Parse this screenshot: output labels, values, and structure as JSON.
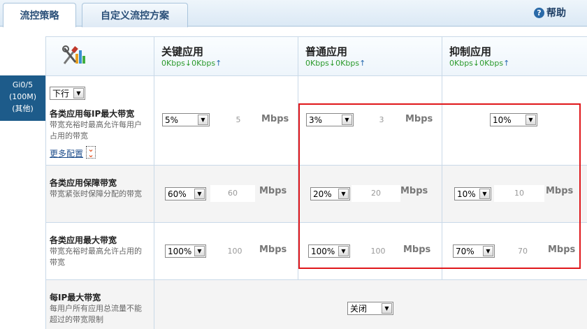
{
  "tabs": [
    {
      "label": "流控策略"
    },
    {
      "label": "自定义流控方案"
    }
  ],
  "help_label": "帮助",
  "port": {
    "line1": "Gi0/5",
    "line2": "(100M)",
    "line3": "(其他)"
  },
  "columns": [
    {
      "title": "关键应用",
      "down": "0Kbps",
      "up": "0Kbps"
    },
    {
      "title": "普通应用",
      "down": "0Kbps",
      "up": "0Kbps"
    },
    {
      "title": "抑制应用",
      "down": "0Kbps",
      "up": "0Kbps"
    }
  ],
  "direction_select": "下行",
  "rows": {
    "per_ip": {
      "title": "各类应用每IP最大带宽",
      "desc": "带宽充裕时最高允许每用户占用的带宽",
      "more": "更多配置",
      "key": {
        "pct": "5%",
        "num": "5"
      },
      "normal": {
        "pct": "3%",
        "num": "3"
      },
      "limit": {
        "pct": "10%"
      },
      "unit": "Mbps"
    },
    "guarantee": {
      "title": "各类应用保障带宽",
      "desc": "带宽紧张时保障分配的带宽",
      "key": {
        "pct": "60%",
        "num": "60"
      },
      "normal": {
        "pct": "20%",
        "num": "20"
      },
      "limit": {
        "pct": "10%",
        "num": "10"
      },
      "unit": "Mbps"
    },
    "max": {
      "title": "各类应用最大带宽",
      "desc": "带宽充裕时最高允许占用的带宽",
      "key": {
        "pct": "100%",
        "num": "100"
      },
      "normal": {
        "pct": "100%",
        "num": "100"
      },
      "limit": {
        "pct": "70%",
        "num": "70"
      },
      "unit": "Mbps"
    },
    "ip_max": {
      "title": "每IP最大带宽",
      "desc": "每用户所有应用总流量不能超过的带宽限制",
      "value": "关闭"
    }
  },
  "colors": {
    "accent": "#1d5b8a",
    "highlight": "#e0161a",
    "kbps": "#2b9a2b"
  },
  "icons": [
    "help-icon",
    "tools-chart-icon",
    "double-chevron-down-icon"
  ]
}
